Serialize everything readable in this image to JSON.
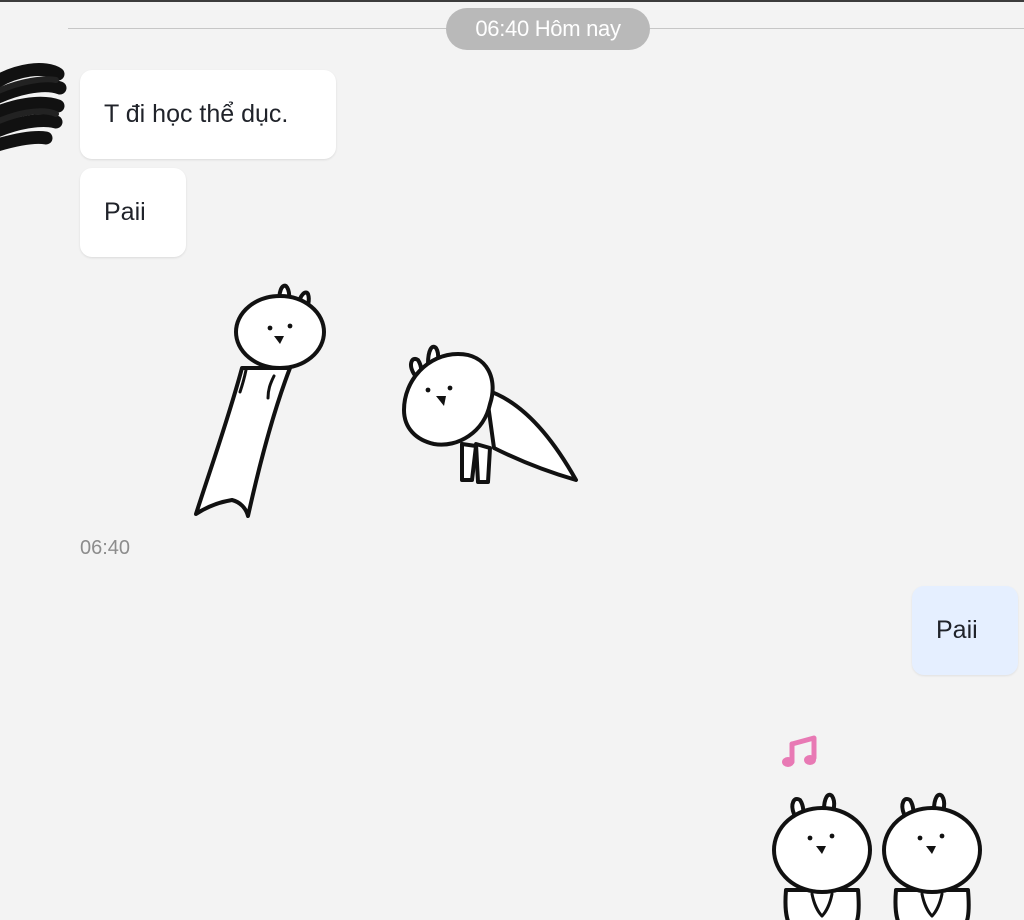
{
  "conversation": {
    "date_separator": "06:40 Hôm nay",
    "messages": [
      {
        "sender": "contact",
        "text": "T đi học thể dục."
      },
      {
        "sender": "contact",
        "text": "Paii"
      },
      {
        "sender": "me",
        "text": "Paii"
      }
    ],
    "group_timestamp": "06:40"
  },
  "icons": {
    "avatar": "avatar-scribbled",
    "sticker_stretch": "rabbit-stretch-sticker",
    "sticker_yoga": "rabbit-yoga-sticker",
    "sticker_duo": "rabbit-duo-music-sticker",
    "music_note": "music-note-icon"
  },
  "colors": {
    "background": "#f3f3f3",
    "contact_bubble": "#ffffff",
    "my_bubble": "#e5efff",
    "date_pill": "#b9b9b9",
    "music_note": "#e879b4"
  }
}
